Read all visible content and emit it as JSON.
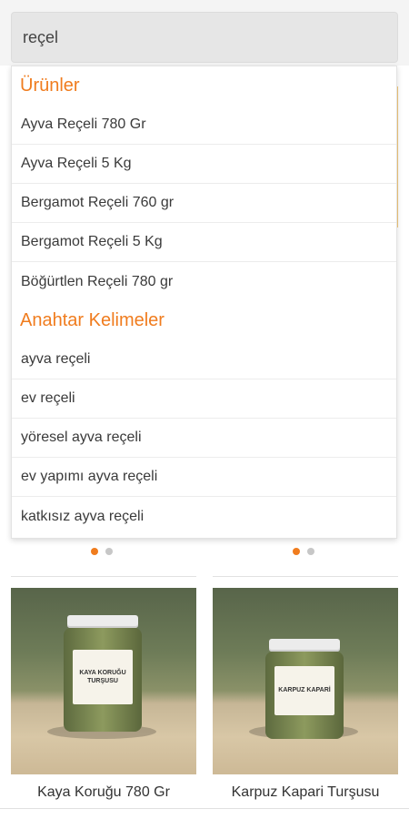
{
  "search": {
    "value": "reçel",
    "placeholder": ""
  },
  "dropdown": {
    "products_header": "Ürünler",
    "products": [
      "Ayva Reçeli 780 Gr",
      "Ayva Reçeli 5 Kg",
      "Bergamot Reçeli 760 gr",
      "Bergamot Reçeli 5 Kg",
      "Böğürtlen Reçeli 780 gr"
    ],
    "keywords_header": "Anahtar Kelimeler",
    "keywords": [
      "ayva reçeli",
      "ev reçeli",
      "yöresel ayva reçeli",
      "ev yapımı ayva reçeli",
      "katkısız ayva reçeli"
    ]
  },
  "carousel": {
    "active_color": "#f07c1e",
    "inactive_color": "#c7c7c7"
  },
  "products": [
    {
      "name": "Kaya Koruğu 780 Gr",
      "jar_label": "KAYA KORUĞU TURŞUSU"
    },
    {
      "name": "Karpuz Kapari Turşusu",
      "jar_label": "KARPUZ KAPARİ"
    }
  ],
  "colors": {
    "accent": "#f07c1e"
  }
}
